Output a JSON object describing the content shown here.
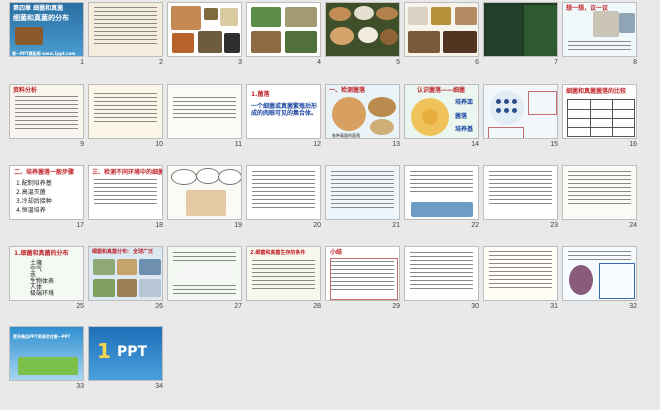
{
  "slides": [
    {
      "num": "1",
      "title": "细菌和真菌的分布",
      "chapter": "第四章 细菌和真菌",
      "footer": "第一PPT模板网 www.1ppt.com"
    },
    {
      "num": "2"
    },
    {
      "num": "3"
    },
    {
      "num": "4"
    },
    {
      "num": "5"
    },
    {
      "num": "6"
    },
    {
      "num": "7"
    },
    {
      "num": "8",
      "heading": "想一想，议一议"
    },
    {
      "num": "9",
      "heading": "资料分析"
    },
    {
      "num": "10"
    },
    {
      "num": "11"
    },
    {
      "num": "12",
      "heading": "1.菌落",
      "body": "一个细菌或真菌繁殖后形成的肉眼可见的集合体。"
    },
    {
      "num": "13",
      "heading": "一、检测菌落",
      "caption": "各种真菌的菌落"
    },
    {
      "num": "14",
      "heading": "认识菌落——细菌",
      "labels": [
        "培养皿",
        "菌落",
        "培养基"
      ]
    },
    {
      "num": "15",
      "heading": "细菌和真菌菌落的比较"
    },
    {
      "num": "16",
      "heading": "二、培养菌落一般步骤",
      "steps": [
        "1.配制培养基",
        "2.高温灭菌",
        "3.冷却后接种",
        "4.恒温培养"
      ]
    },
    {
      "num": "17",
      "heading": "三、检测不同环境中的细菌和真菌"
    },
    {
      "num": "18"
    },
    {
      "num": "19"
    },
    {
      "num": "20"
    },
    {
      "num": "21"
    },
    {
      "num": "22"
    },
    {
      "num": "23"
    },
    {
      "num": "24"
    },
    {
      "num": "25",
      "heading": "1.细菌和真菌的分布",
      "items": [
        "土壤",
        "空气",
        "水",
        "生物体表",
        "人体",
        "极端环境"
      ]
    },
    {
      "num": "26",
      "heading": "细菌和真菌分布:",
      "subheading": "全球广泛"
    },
    {
      "num": "27"
    },
    {
      "num": "28",
      "heading": "2.细菌和真菌生存的条件"
    },
    {
      "num": "29",
      "heading": "小结"
    },
    {
      "num": "30"
    },
    {
      "num": "31"
    },
    {
      "num": "32"
    },
    {
      "num": "33",
      "title": "更多精品PPT资源尽在第一PPT"
    },
    {
      "num": "34",
      "logo_num": "1",
      "logo_text": "PPT"
    }
  ],
  "colors": {
    "pane_bg": "#e9e9e9",
    "selection": "#2b64c8",
    "title_red": "#c0262c",
    "title_blue": "#1e4aa3"
  }
}
